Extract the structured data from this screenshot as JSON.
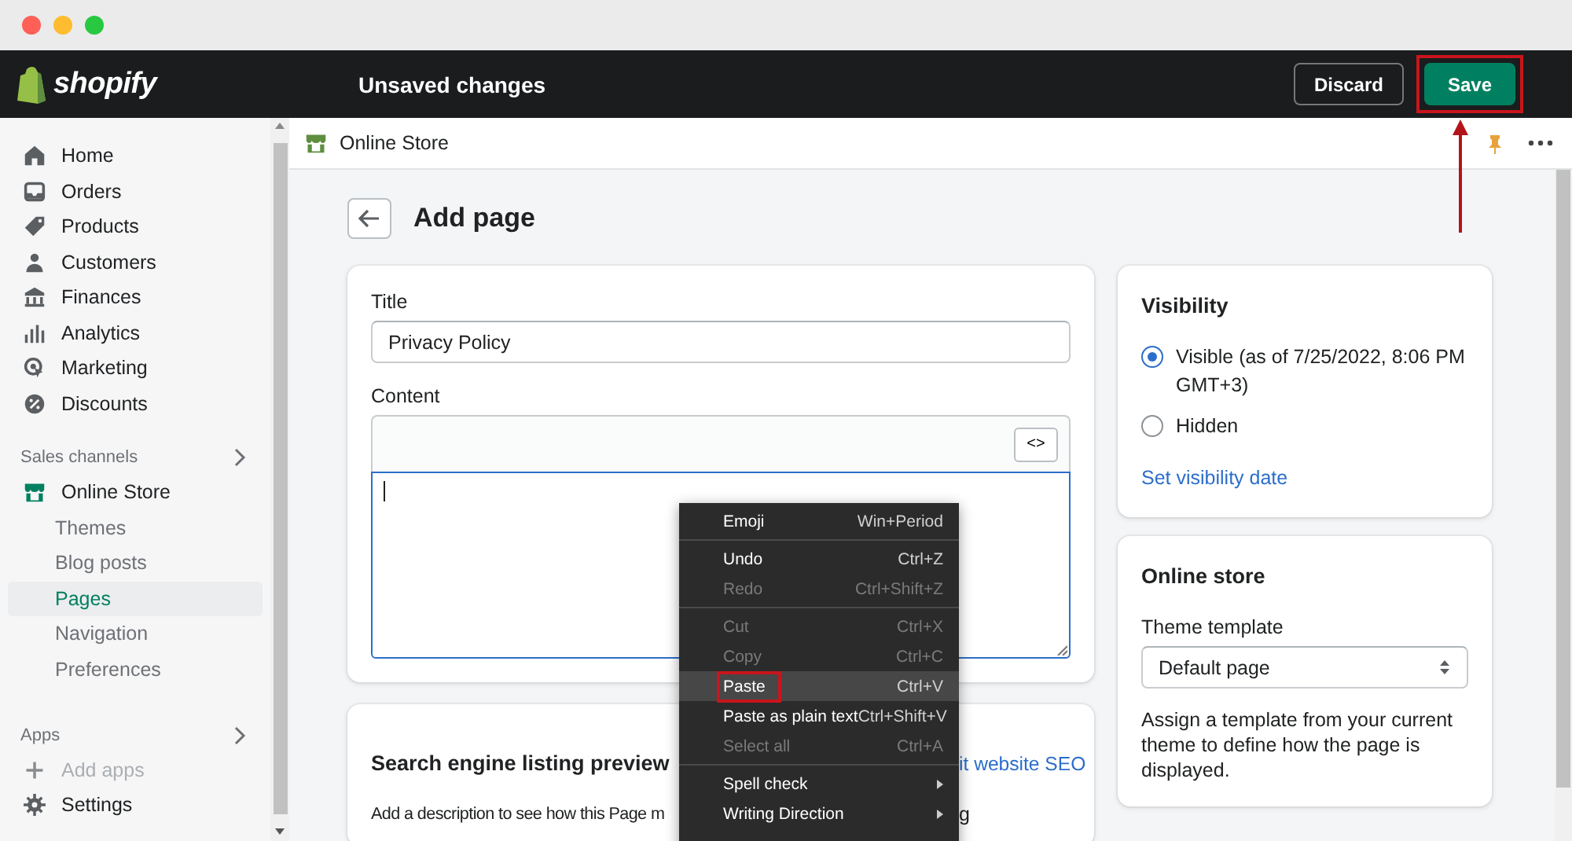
{
  "topbar": {
    "logo": "shopify",
    "title": "Unsaved changes",
    "buttons": [
      {
        "label": "Discard",
        "kind": "secondary",
        "outlined": false
      },
      {
        "label": "Save",
        "kind": "primary",
        "outlined": true
      }
    ]
  },
  "sidebar": {
    "items": [
      {
        "label": "Home",
        "selected": false
      },
      {
        "label": "Orders",
        "selected": false
      },
      {
        "label": "Products",
        "selected": false
      },
      {
        "label": "Customers",
        "selected": false
      },
      {
        "label": "Finances",
        "selected": false
      },
      {
        "label": "Analytics",
        "selected": false
      },
      {
        "label": "Marketing",
        "selected": false
      },
      {
        "label": "Discounts",
        "selected": false
      }
    ],
    "sales_channels": {
      "heading": "Sales channels",
      "items": [
        {
          "label": "Online Store",
          "selected": false,
          "children": [
            {
              "label": "Themes",
              "selected": false
            },
            {
              "label": "Blog posts",
              "selected": false
            },
            {
              "label": "Pages",
              "selected": true
            },
            {
              "label": "Navigation",
              "selected": false
            },
            {
              "label": "Preferences",
              "selected": false
            }
          ]
        }
      ]
    },
    "apps": {
      "heading": "Apps",
      "items": [
        {
          "label": "Add apps",
          "disabled": true
        }
      ]
    },
    "settings": "Settings"
  },
  "breadcrumb": "Online Store",
  "page_title": "Add page",
  "page_form": {
    "title_label": "Title",
    "title_value": "Privacy Policy",
    "content_label": "Content",
    "html_toggle": "<>"
  },
  "search_preview": {
    "heading": "Search engine listing preview",
    "link": "it website SEO",
    "description_start": "Add a description to see how this Page m",
    "description_end": "g"
  },
  "visibility": {
    "heading": "Visibility",
    "options": [
      {
        "label": "Visible (as of 7/25/2022, 8:06 PM GMT+3)",
        "selected": true
      },
      {
        "label": "Hidden",
        "selected": false
      }
    ],
    "link": "Set visibility date"
  },
  "online_store": {
    "heading": "Online store",
    "field_label": "Theme template",
    "value": "Default page",
    "help": "Assign a template from your current theme to define how the page is displayed."
  },
  "context_menu": {
    "groups": [
      [
        {
          "label": "Emoji",
          "shortcut": "Win+Period",
          "disabled": false,
          "highlighted": false,
          "outlined": false,
          "submenu": false
        }
      ],
      [
        {
          "label": "Undo",
          "shortcut": "Ctrl+Z",
          "disabled": false,
          "highlighted": false,
          "outlined": false,
          "submenu": false
        },
        {
          "label": "Redo",
          "shortcut": "Ctrl+Shift+Z",
          "disabled": true,
          "highlighted": false,
          "outlined": false,
          "submenu": false
        }
      ],
      [
        {
          "label": "Cut",
          "shortcut": "Ctrl+X",
          "disabled": true,
          "highlighted": false,
          "outlined": false,
          "submenu": false
        },
        {
          "label": "Copy",
          "shortcut": "Ctrl+C",
          "disabled": true,
          "highlighted": false,
          "outlined": false,
          "submenu": false
        },
        {
          "label": "Paste",
          "shortcut": "Ctrl+V",
          "disabled": false,
          "highlighted": true,
          "outlined": true,
          "submenu": false
        },
        {
          "label": "Paste as plain text",
          "shortcut": "Ctrl+Shift+V",
          "disabled": false,
          "highlighted": false,
          "outlined": false,
          "submenu": false
        },
        {
          "label": "Select all",
          "shortcut": "Ctrl+A",
          "disabled": true,
          "highlighted": false,
          "outlined": false,
          "submenu": false
        }
      ],
      [
        {
          "label": "Spell check",
          "disabled": false,
          "highlighted": false,
          "outlined": false,
          "submenu": true
        },
        {
          "label": "Writing Direction",
          "disabled": false,
          "highlighted": false,
          "outlined": false,
          "submenu": true
        }
      ]
    ]
  }
}
